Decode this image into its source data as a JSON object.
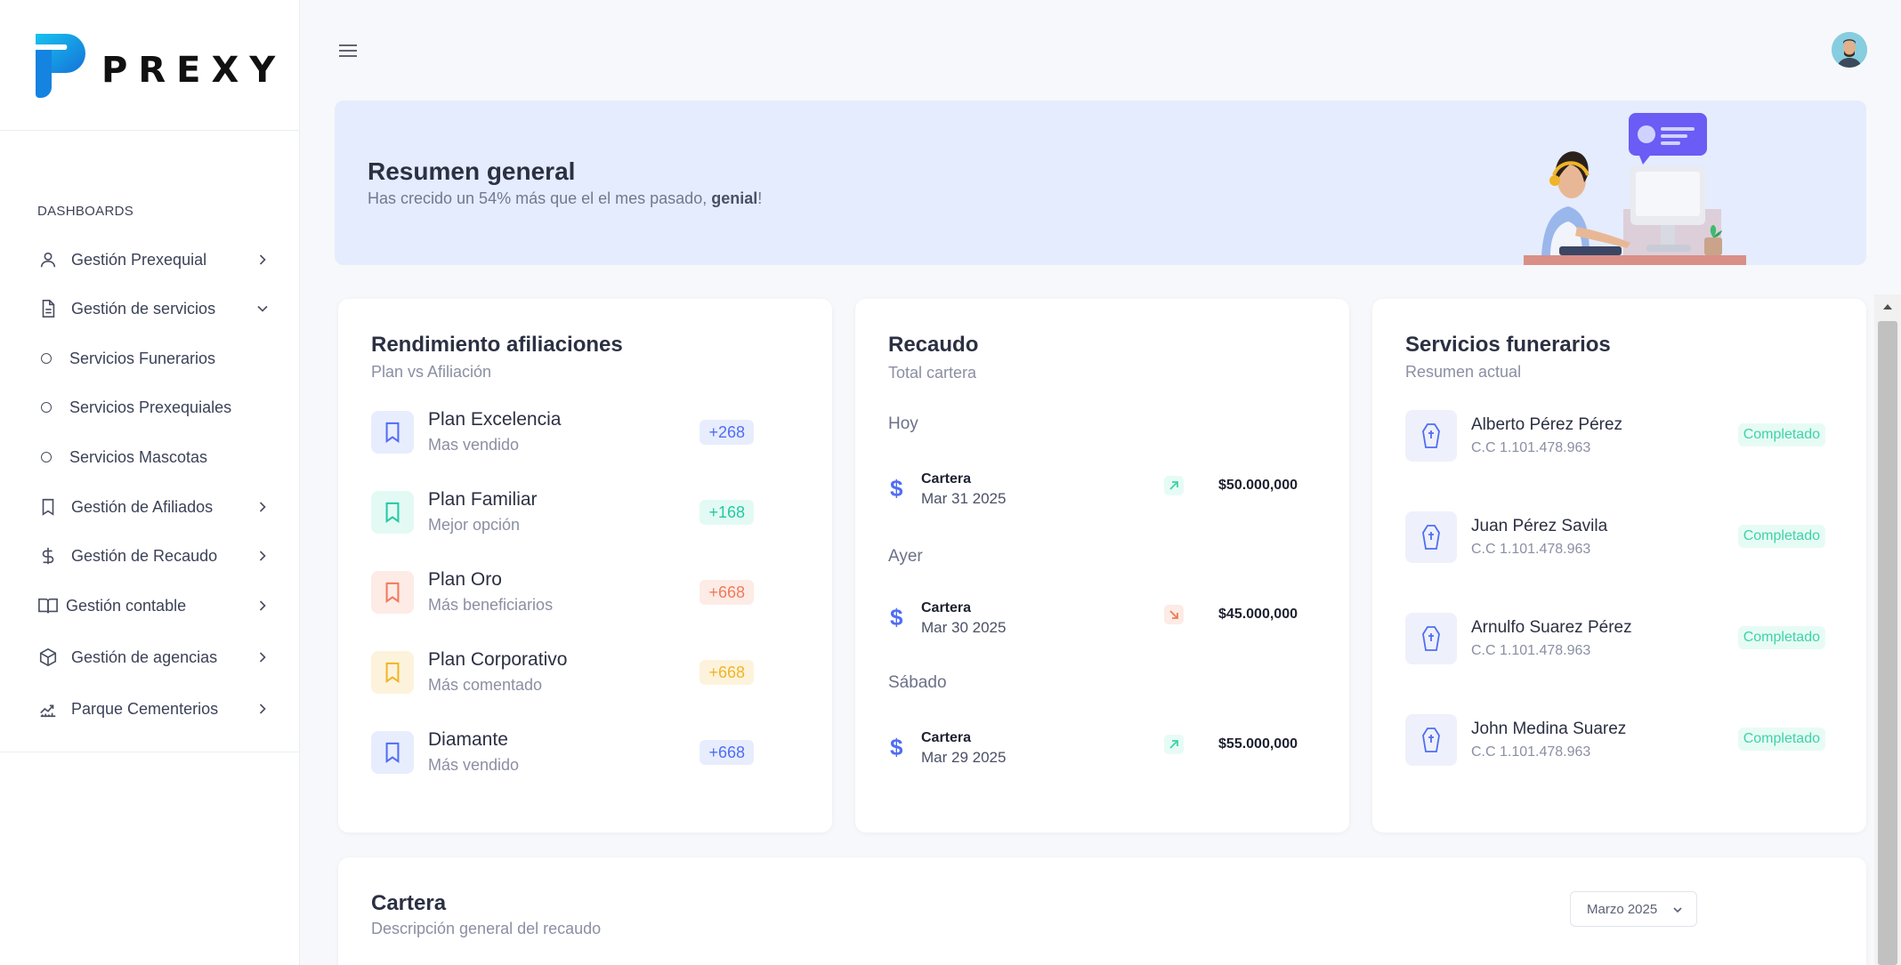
{
  "brand": {
    "name": "PREXY"
  },
  "sidebar": {
    "section_title": "DASHBOARDS",
    "items": [
      {
        "label": "Gestión Prexequial",
        "icon": "user-icon"
      },
      {
        "label": "Gestión de servicios",
        "icon": "document-icon"
      },
      {
        "label": "Gestión de Afiliados",
        "icon": "bookmark-icon"
      },
      {
        "label": "Gestión de Recaudo",
        "icon": "dollar-icon"
      },
      {
        "label": "Gestión contable",
        "icon": "book-icon"
      },
      {
        "label": "Gestión de agencias",
        "icon": "box-icon"
      },
      {
        "label": "Parque Cementerios",
        "icon": "chart-up-icon"
      }
    ],
    "subitems": [
      {
        "label": "Servicios Funerarios"
      },
      {
        "label": "Servicios Prexequiales"
      },
      {
        "label": "Servicios Mascotas"
      }
    ]
  },
  "banner": {
    "title": "Resumen general",
    "subtitle_pre": "Has crecido un 54% más que el el mes pasado, ",
    "subtitle_bold": "genial",
    "subtitle_post": "!"
  },
  "afiliaciones": {
    "title": "Rendimiento afiliaciones",
    "subtitle": "Plan vs Afiliación",
    "plans": [
      {
        "name": "Plan Excelencia",
        "desc": "Mas vendido",
        "badge": "+268",
        "color": "#4f6df5",
        "bg": "#e8edfd"
      },
      {
        "name": "Plan Familiar",
        "desc": "Mejor opción",
        "badge": "+168",
        "color": "#25c8a4",
        "bg": "#e3faf4"
      },
      {
        "name": "Plan Oro",
        "desc": "Más beneficiarios",
        "badge": "+668",
        "color": "#f07a5b",
        "bg": "#fdebe6"
      },
      {
        "name": "Plan Corporativo",
        "desc": "Más comentado",
        "badge": "+668",
        "color": "#f0b428",
        "bg": "#fdf3dc"
      },
      {
        "name": "Diamante",
        "desc": "Más vendido",
        "badge": "+668",
        "color": "#4f6df5",
        "bg": "#e8edfd"
      }
    ]
  },
  "recaudo": {
    "title": "Recaudo",
    "subtitle": "Total cartera",
    "groups": [
      {
        "day": "Hoy",
        "label": "Cartera",
        "date": "Mar 31 2025",
        "amount": "$50.000,000",
        "trend": "up"
      },
      {
        "day": "Ayer",
        "label": "Cartera",
        "date": "Mar 30 2025",
        "amount": "$45.000,000",
        "trend": "down"
      },
      {
        "day": "Sábado",
        "label": "Cartera",
        "date": "Mar 29 2025",
        "amount": "$55.000,000",
        "trend": "up"
      }
    ]
  },
  "funerarios": {
    "title": "Servicios funerarios",
    "subtitle": "Resumen actual",
    "items": [
      {
        "name": "Alberto Pérez Pérez",
        "id": "C.C 1.101.478.963",
        "status": "Completado"
      },
      {
        "name": "Juan Pérez Savila",
        "id": "C.C 1.101.478.963",
        "status": "Completado"
      },
      {
        "name": "Arnulfo Suarez Pérez",
        "id": "C.C 1.101.478.963",
        "status": "Completado"
      },
      {
        "name": "John Medina Suarez",
        "id": "C.C 1.101.478.963",
        "status": "Completado"
      }
    ]
  },
  "cartera": {
    "title": "Cartera",
    "subtitle": "Descripción general del recaudo",
    "period": "Marzo 2025"
  },
  "colors": {
    "accent": "#4f6df5",
    "success": "#3ed3a5",
    "danger": "#f07a5b",
    "banner_bg": "#e5ecfd",
    "logo": "#1a9be8"
  }
}
